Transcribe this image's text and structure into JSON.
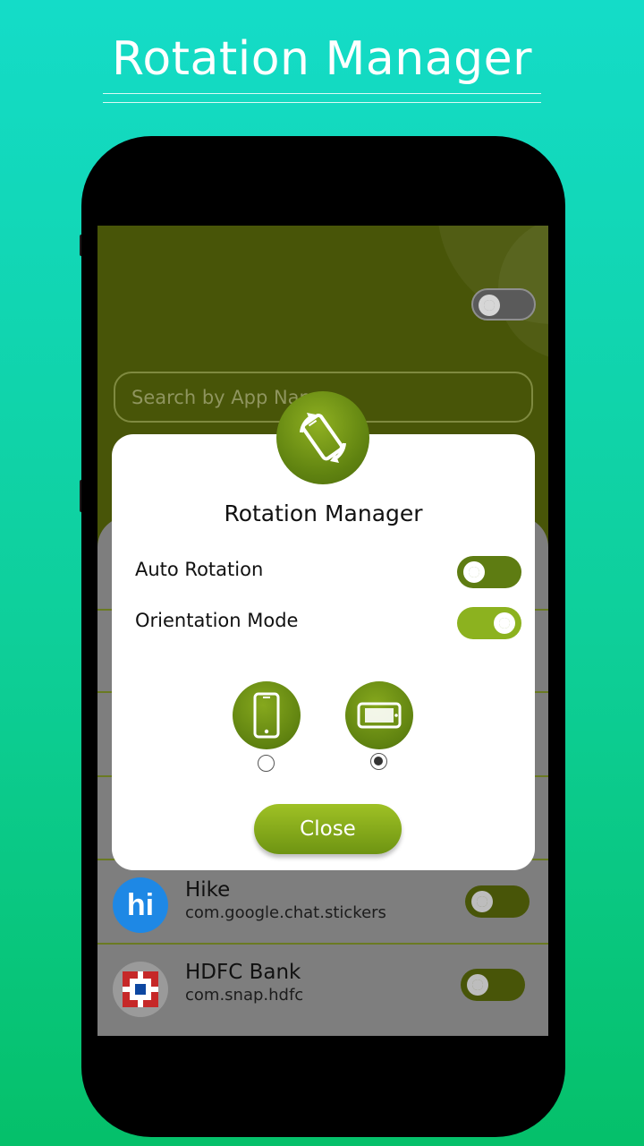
{
  "promo": {
    "title": "Rotation Manager"
  },
  "header": {
    "search_placeholder": "Search by App Name",
    "master_toggle_on": false
  },
  "apps": [
    {
      "name": "Hike",
      "package": "com.google.chat.stickers",
      "icon": "hike-logo-icon",
      "icon_text": "hi",
      "enabled": false
    },
    {
      "name": "HDFC Bank",
      "package": "com.snap.hdfc",
      "icon": "hdfc-logo-icon",
      "enabled": false
    }
  ],
  "dialog": {
    "title": "Rotation Manager",
    "auto_rotation_label": "Auto Rotation",
    "auto_rotation_on": false,
    "orientation_mode_label": "Orientation Mode",
    "orientation_mode_on": true,
    "orientation_options": [
      {
        "icon": "portrait-phone-icon",
        "selected": false
      },
      {
        "icon": "landscape-phone-icon",
        "selected": true
      }
    ],
    "close_label": "Close"
  },
  "colors": {
    "background_top": "#14dcc8",
    "background_bottom": "#05c06a",
    "header": "#485508",
    "accent": "#8cb21f",
    "accent_dark": "#5e7c12",
    "hike_blue": "#1e88e5",
    "hdfc_red": "#c62828",
    "hdfc_blue": "#0d47a1"
  }
}
